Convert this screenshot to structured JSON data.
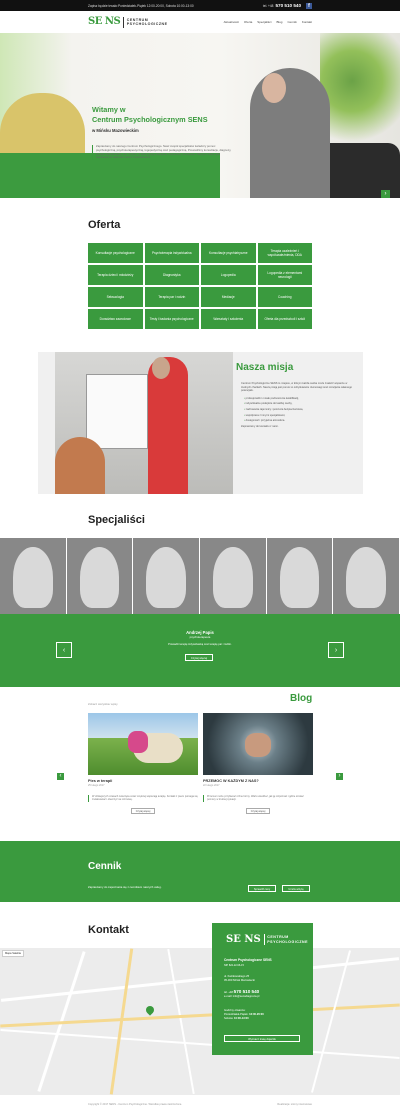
{
  "topbar": {
    "info_prefix": "Zapisz będzie trwało: ",
    "info": "Poniedziałek-Piątek 12:00-20:00, Sobota 10:00-13:00",
    "phone_prefix": "tel. +48",
    "phone": "570 510 540",
    "fb_glyph": "f"
  },
  "logo": {
    "mark": "SE NS",
    "line1": "CENTRUM",
    "line2": "PSYCHOLOGICZNE"
  },
  "nav": [
    "Aktualności",
    "Oferta",
    "Specjaliści",
    "Blog",
    "Cennik",
    "Kontakt"
  ],
  "hero": {
    "title_line1": "Witamy w",
    "title_line2": "Centrum Psychologicznym SENS",
    "subtitle": "w Mińsku Mazowieckim",
    "description": "Zapraszamy do naszego Centrum Psychologicznego. Nasz zespół specjalistów świadczy pomoc psychologiczną, psychoterapeutyczną, logopedyczną oraz pedagogiczną. Prowadzimy konsultacje, diagnozy, terapie indywidualne, par i rodzin, a także grupy wsparcia i warsztaty rozwojowe. Naszym celem jest wspieranie w radzeniu sobie z trudnościami."
  },
  "oferta": {
    "title": "Oferta",
    "items": [
      "Konsultacje psychologiczne",
      "Psychoterapia indywidualna",
      "Konsultacje psychiatryczne",
      "Terapia uzależnień i współuzależnienia, DDA",
      "Terapia dzieci i młodzieży",
      "Diagnostyka",
      "Logopedia",
      "Logopedia z elementami neurologii",
      "Seksuologia",
      "Terapia par i rodzin",
      "Mediacje",
      "Coaching",
      "Doradztwo zawodowe",
      "Testy i badania psychologiczne",
      "Warsztaty i szkolenia",
      "Oferta dla przedszkoli i szkół"
    ]
  },
  "misja": {
    "title": "Nasza misja",
    "intro": "Centrum Psychologiczne SENS to miejsce, w którym każda osoba może znaleźć wsparcie w trudnych chwilach. Naszą misją jest pomoc w odzyskiwaniu równowagi oraz rozwijanie własnego potencjału.",
    "points": [
      "profesjonalizm i stałe podnoszenie kwalifikacji,",
      "indywidualne podejście do każdej osoby,",
      "zachowanie tajemnicy i poczucia bezpieczeństwa,",
      "współpraca z innymi specjalistami,",
      "dostępność i przyjazna atmosfera."
    ],
    "outro": "Zapraszamy do kontaktu z nami."
  },
  "specjalisci": {
    "title": "Specjaliści",
    "name": "Andrzej Papis",
    "role": "psychoterapeuta",
    "bio": "Prowadzi terapię indywidualną oraz terapię par i rodzin.",
    "btn": "Czytaj więcej",
    "prev": "‹",
    "next": "›"
  },
  "blog": {
    "title": "Blog",
    "small": "Zobacz wszystkie wpisy",
    "prev": "‹",
    "next": "›",
    "posts": [
      {
        "title": "Pies w terapii",
        "date": "25 lutego 2017",
        "excerpt": "W dzisiejszych czasach zwierzęta coraz częściej wspierają terapię. Kontakt z psem pomaga się zrelaksować i otworzyć na rozmowę.",
        "more": "Czytaj więcej"
      },
      {
        "title": "PRZEMOC W KAŻDYM Z NAS?",
        "date": "22 lutego 2017",
        "excerpt": "Przemoc może przybierać różne formy. Warto wiedzieć, jak ją rozpoznać i gdzie szukać pomocy w trudnej sytuacji.",
        "more": "Czytaj więcej"
      }
    ]
  },
  "cennik": {
    "title": "Cennik",
    "text": "Zapraszamy do zapoznania się z cennikiem naszych usług.",
    "btn1": "Sprawdź ceny",
    "btn2": "Umów wizytę"
  },
  "kontakt": {
    "title": "Kontakt",
    "name": "Centrum Psychologiczne SENS",
    "nip": "NIP 822-22-96-15",
    "addr1": "ul. Kazikowskiego 25",
    "addr2": "05-300 Mińsk Mazowiecki",
    "tel_prefix": "tel. +48",
    "tel": "570 510 540",
    "email": "e-mail: info@sensdiagnoza.pl",
    "hours_label": "Godziny otwarcia:",
    "hours1_label": "Poniedziałek-Piątek: ",
    "hours1": "12:00-20:00",
    "hours2_label": "Sobota: ",
    "hours2": "10:00-13:00",
    "route": "Wyznacz trasę dojazdu",
    "map_ctrl": "Mapa  Satelita"
  },
  "footer": {
    "left": "Copyright © 2017 SENS - Centrum Psychologiczne. Wszelkie prawa zastrzeżone.",
    "right": "Realizacja: strony internetowe"
  },
  "colors": {
    "accent": "#3a9a3e",
    "dark": "#111111"
  }
}
